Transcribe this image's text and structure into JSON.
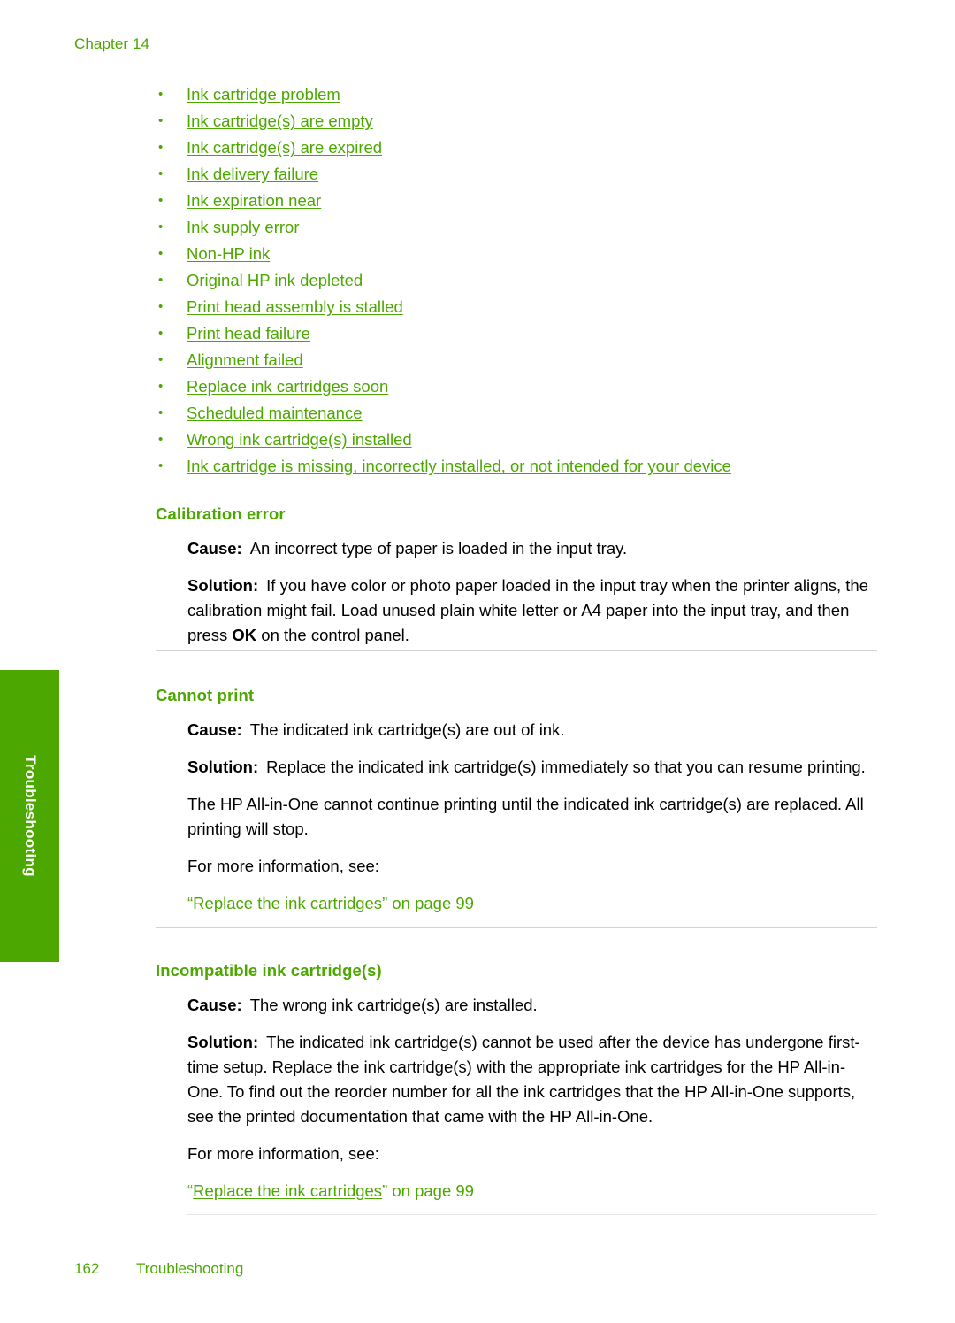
{
  "header": {
    "chapter": "Chapter 14"
  },
  "side_tab": {
    "label": "Troubleshooting",
    "color": "#4CA800",
    "text_color": "#FFFFFF"
  },
  "colors": {
    "accent_green": "#4CA800",
    "link_green": "#4CA800",
    "rule_gray": "#D3D3D3",
    "body_black": "#000000"
  },
  "xref_list": {
    "bullet_glyph": "•",
    "items": [
      {
        "label": "Ink cartridge problem"
      },
      {
        "label": "Ink cartridge(s) are empty"
      },
      {
        "label": "Ink cartridge(s) are expired"
      },
      {
        "label": "Ink delivery failure"
      },
      {
        "label": "Ink expiration near"
      },
      {
        "label": "Ink supply error"
      },
      {
        "label": "Non-HP ink"
      },
      {
        "label": "Original HP ink depleted"
      },
      {
        "label": "Print head assembly is stalled"
      },
      {
        "label": "Print head failure"
      },
      {
        "label": "Alignment failed"
      },
      {
        "label": "Replace ink cartridges soon"
      },
      {
        "label": "Scheduled maintenance"
      },
      {
        "label": "Wrong ink cartridge(s) installed"
      },
      {
        "label": "Ink cartridge is missing, incorrectly installed, or not intended for your device"
      }
    ]
  },
  "sections": [
    {
      "heading": "Calibration error",
      "cause_label": "Cause:",
      "cause_text": "An incorrect type of paper is loaded in the input tray.",
      "solution_label": "Solution:",
      "solution_text_part1": "If you have color or photo paper loaded in the input tray when the printer aligns, the calibration might fail. Load unused plain white letter or A4 paper into the input tray, and then press ",
      "solution_emphasis": "OK",
      "solution_text_part2": " on the control panel."
    },
    {
      "heading": "Cannot print",
      "cause_label": "Cause:",
      "cause_text": "The indicated ink cartridge(s) are out of ink.",
      "solution_label": "Solution:",
      "solution_text": "Replace the indicated ink cartridge(s) immediately so that you can resume printing.",
      "extra_paragraph": "The HP All-in-One cannot continue printing until the indicated ink cartridge(s) are replaced. All printing will stop.",
      "more_info": "For more information, see:",
      "xref_open_quote": "“",
      "xref_link": "Replace the ink cartridges",
      "xref_close_quote": "”",
      "xref_page": " on page 99"
    },
    {
      "heading": "Incompatible ink cartridge(s)",
      "cause_label": "Cause:",
      "cause_text": "The wrong ink cartridge(s) are installed.",
      "solution_label": "Solution:",
      "solution_text": "The indicated ink cartridge(s) cannot be used after the device has undergone first-time setup. Replace the ink cartridge(s) with the appropriate ink cartridges for the HP All-in-One. To find out the reorder number for all the ink cartridges that the HP All-in-One supports, see the printed documentation that came with the HP All-in-One.",
      "more_info": "For more information, see:",
      "xref_open_quote": "“",
      "xref_link": "Replace the ink cartridges",
      "xref_close_quote": "”",
      "xref_page": " on page 99"
    }
  ],
  "footer": {
    "page_number": "162",
    "section_name": "Troubleshooting"
  }
}
